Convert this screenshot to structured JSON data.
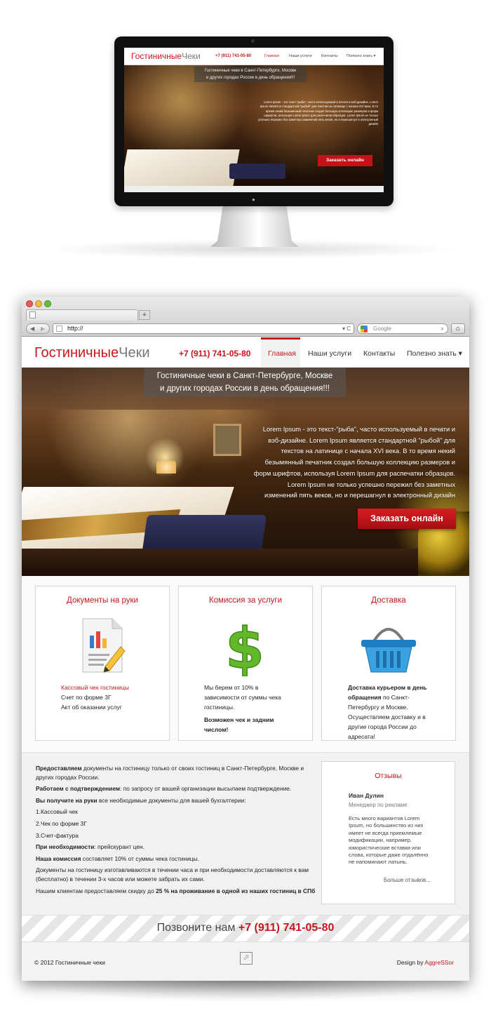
{
  "monitor": {
    "logo_red": "Гостиничные",
    "logo_gray": "Чеки",
    "phone": "+7 (911) 741-05-80",
    "nav": [
      "Главная",
      "Наши услуги",
      "Контакты",
      "Полезно знать ▾"
    ],
    "tagline_1": "Гостиничные чеки в Санкт-Петербурге, Москве",
    "tagline_2": "и других городах России в день обращения!!!",
    "hero_text": "Lorem Ipsum - это текст-\"рыба\", часто используемый в печати и вэб-дизайне. Lorem Ipsum является стандартной \"рыбой\" для текстов на латинице с начала XVI века. В то время некий безымянный печатник создал большую коллекцию размеров и форм шрифтов, используя Lorem Ipsum для распечатки образцов. Lorem Ipsum не только успешно пережил без заметных изменений пять веков, но и перешагнул в электронный дизайн",
    "order_button": "Заказать онлайн"
  },
  "browser": {
    "url": "http://",
    "search_placeholder": "Google",
    "new_tab": "+"
  },
  "header": {
    "logo_red": "Гостиничные",
    "logo_gray": "Чеки",
    "phone": "+7 (911) 741-05-80",
    "nav": {
      "home": "Главная",
      "services": "Наши услуги",
      "contacts": "Контакты",
      "useful": "Полезно знать ▾"
    }
  },
  "hero": {
    "tagline_1": "Гостиничные чеки в Санкт-Петербурге, Москве",
    "tagline_2": "и других городах России в день обращения!!!",
    "text": "Lorem Ipsum - это текст-\"рыба\", часто используемый в печати и вэб-дизайне. Lorem Ipsum является стандартной \"рыбой\" для текстов на латинице с начала XVI века. В то время некий безымянный печатник создал большую коллекцию размеров и форм шрифтов, используя Lorem Ipsum для распечатки образцов. Lorem Ipsum не только успешно пережил без заметных изменений пять веков, но и перешагнул в электронный дизайн",
    "order_button": "Заказать онлайн"
  },
  "features": {
    "docs": {
      "title": "Документы на руки",
      "line1": "Кассовый чек гостиницы",
      "line2": "Счет по форме 3Г",
      "line3": "Акт об оказании услуг"
    },
    "commission": {
      "title": "Комиссия за услуги",
      "text": "Мы берем от 10% в зависимости от суммы чека гостиницы.",
      "bold": "Возможен чек и задним числом!"
    },
    "delivery": {
      "title": "Доставка",
      "bold": "Доставка курьером в день обращения",
      "text": "по Санкт-Петербургу и Москве. Осуществляем доставку и в другие города России до адресата!"
    }
  },
  "info": {
    "p1_bold": "Предоставляем",
    "p1": "документы на гостиницу только от своих гостиниц в Санкт-Петербурге, Москве и других городах России.",
    "p2_bold": "Работаем с подтверждением",
    "p2": ": по запросу от вашей организации высылаем подтверждение.",
    "p3_bold": "Вы получите на руки",
    "p3": "все необходимые документы для вашей бухгалтерии:",
    "li1": "1.Кассовый чек",
    "li2": "2.Чек по форме 3Г",
    "li3": "3.Счет-фактура",
    "p4_bold": "При необходимости",
    "p4": ": прейскурант цен.",
    "p5_bold": "Наша комиссия",
    "p5": "составляет 10% от суммы чека гостиницы.",
    "p6": "Документы на гостиницу изготавливаются в течении часа и при необходимости доставляются к вам (бесплатно) в течении 3-х часов или можете забрать их сами.",
    "p7": "Нашим клиентам предоставляем скидку до",
    "p7_bold": "25 % на проживание в одной из наших гостиниц в СПб"
  },
  "reviews": {
    "title": "Отзывы",
    "name": "Иван Дулин",
    "role": "Менеджер по рекламе",
    "quote": "Есть много вариантов Lorem Ipsum, но большинство из них имеет не всегда приемлемые модификации, например, юмористические вставки или слова, которые даже отдалённо не напоминают латынь.",
    "more": "Больше отзывов..."
  },
  "callbar": {
    "text": "Позвоните нам",
    "phone": "+7 (911) 741-05-80"
  },
  "footer": {
    "copyright": "© 2012 Гостиничные чеки",
    "design_by": "Design by",
    "designer": "AggreSSor"
  },
  "colors": {
    "accent": "#c8161d"
  }
}
